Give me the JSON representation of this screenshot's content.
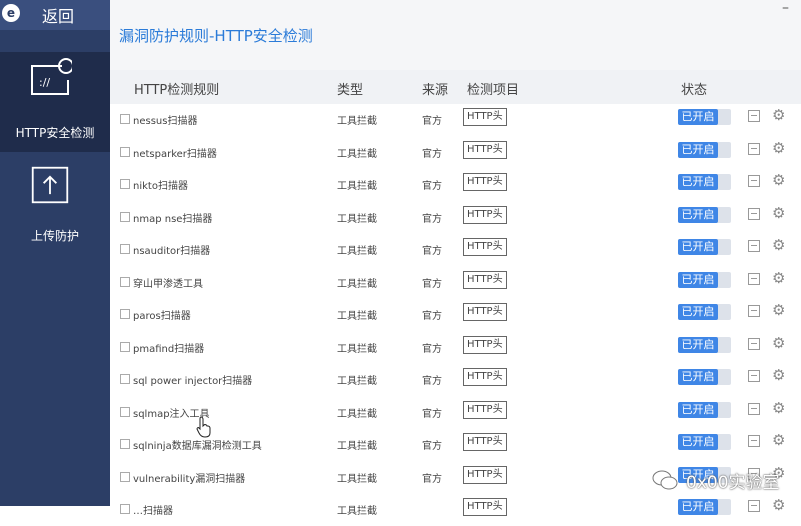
{
  "sidebar": {
    "back_icon": "e",
    "back_label": "返回",
    "items": [
      {
        "label": "HTTP安全检测",
        "icon": "http-window-icon",
        "active": true
      },
      {
        "label": "上传防护",
        "icon": "upload-icon",
        "active": false
      }
    ]
  },
  "header": {
    "title": "漏洞防护规则-HTTP安全检测",
    "minimize_glyph": "–"
  },
  "columns": {
    "rule": "HTTP检测规则",
    "type": "类型",
    "source": "来源",
    "item": "检测项目",
    "status": "状态"
  },
  "rows": [
    {
      "name": "nessus扫描器",
      "type": "工具拦截",
      "source": "官方",
      "item": "HTTP头",
      "status": "已开启"
    },
    {
      "name": "netsparker扫描器",
      "type": "工具拦截",
      "source": "官方",
      "item": "HTTP头",
      "status": "已开启"
    },
    {
      "name": "nikto扫描器",
      "type": "工具拦截",
      "source": "官方",
      "item": "HTTP头",
      "status": "已开启"
    },
    {
      "name": "nmap nse扫描器",
      "type": "工具拦截",
      "source": "官方",
      "item": "HTTP头",
      "status": "已开启"
    },
    {
      "name": "nsauditor扫描器",
      "type": "工具拦截",
      "source": "官方",
      "item": "HTTP头",
      "status": "已开启"
    },
    {
      "name": "穿山甲渗透工具",
      "type": "工具拦截",
      "source": "官方",
      "item": "HTTP头",
      "status": "已开启"
    },
    {
      "name": "paros扫描器",
      "type": "工具拦截",
      "source": "官方",
      "item": "HTTP头",
      "status": "已开启"
    },
    {
      "name": "pmafind扫描器",
      "type": "工具拦截",
      "source": "官方",
      "item": "HTTP头",
      "status": "已开启"
    },
    {
      "name": "sql power injector扫描器",
      "type": "工具拦截",
      "source": "官方",
      "item": "HTTP头",
      "status": "已开启"
    },
    {
      "name": "sqlmap注入工具",
      "type": "工具拦截",
      "source": "官方",
      "item": "HTTP头",
      "status": "已开启"
    },
    {
      "name": "sqlninja数据库漏洞检测工具",
      "type": "工具拦截",
      "source": "官方",
      "item": "HTTP头",
      "status": "已开启"
    },
    {
      "name": "vulnerability漏洞扫描器",
      "type": "工具拦截",
      "source": "官方",
      "item": "HTTP头",
      "status": "已开启"
    },
    {
      "name": "…扫描器",
      "type": "工具拦截",
      "source": "",
      "item": "HTTP头",
      "status": "已开启"
    }
  ],
  "watermark": {
    "text": "0x00实验室"
  },
  "colors": {
    "sidebar": "#2c3e66",
    "accent": "#3f86e6",
    "title": "#2b7bd8"
  }
}
